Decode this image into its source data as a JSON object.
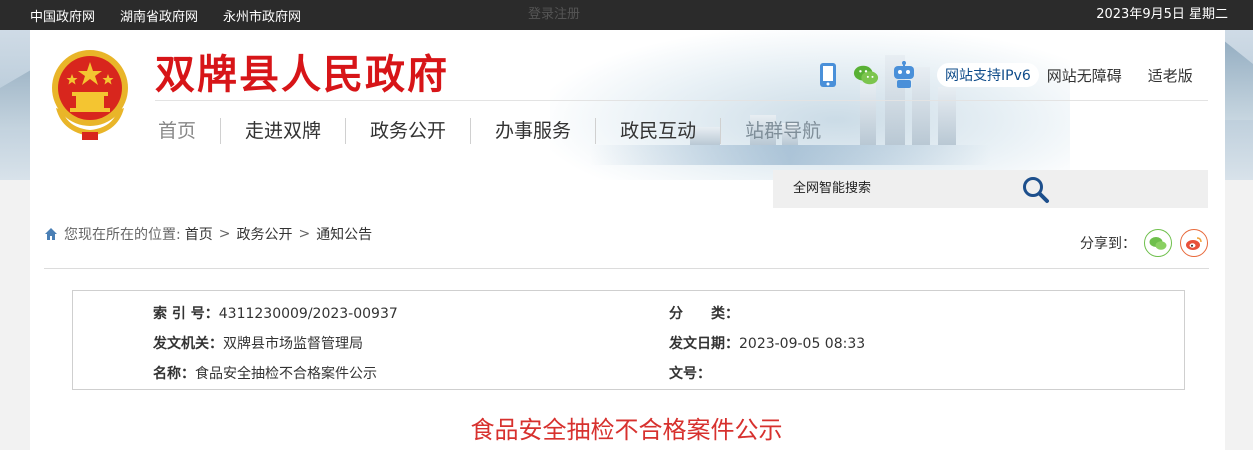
{
  "topbar": {
    "links": [
      "中国政府网",
      "湖南省政府网",
      "永州市政府网"
    ],
    "login": "登录注册",
    "date": "2023年9月5日 星期二"
  },
  "header": {
    "site_title": "双牌县人民政府",
    "ipv6": "网站支持IPv6",
    "accessible": "网站无障碍",
    "elderly": "适老版"
  },
  "nav": [
    "首页",
    "走进双牌",
    "政务公开",
    "办事服务",
    "政民互动",
    "站群导航"
  ],
  "search": {
    "placeholder": "全网智能搜索"
  },
  "breadcrumb": {
    "prefix": "您现在所在的位置:",
    "items": [
      "首页",
      "政务公开",
      "通知公告"
    ]
  },
  "share": {
    "label": "分享到："
  },
  "meta": {
    "index_label": "索 引 号：",
    "index_value": "4311230009/2023-00937",
    "category_label": "分　　类：",
    "category_value": "",
    "issuer_label": "发文机关：",
    "issuer_value": "双牌县市场监督管理局",
    "date_label": "发文日期：",
    "date_value": "2023-09-05 08:33",
    "name_label": "名称：",
    "name_value": "食品安全抽检不合格案件公示",
    "docno_label": "文号：",
    "docno_value": ""
  },
  "article": {
    "title": "食品安全抽检不合格案件公示"
  },
  "colors": {
    "brand_red": "#d71518",
    "title_red": "#d7312e",
    "topbar": "#2b2b2b",
    "link_blue": "#0f4c8a"
  },
  "icons": [
    "emblem-icon",
    "mobile-icon",
    "wechat-icon",
    "robot-icon",
    "search-icon",
    "home-icon",
    "wechat-share-icon",
    "weibo-share-icon"
  ]
}
